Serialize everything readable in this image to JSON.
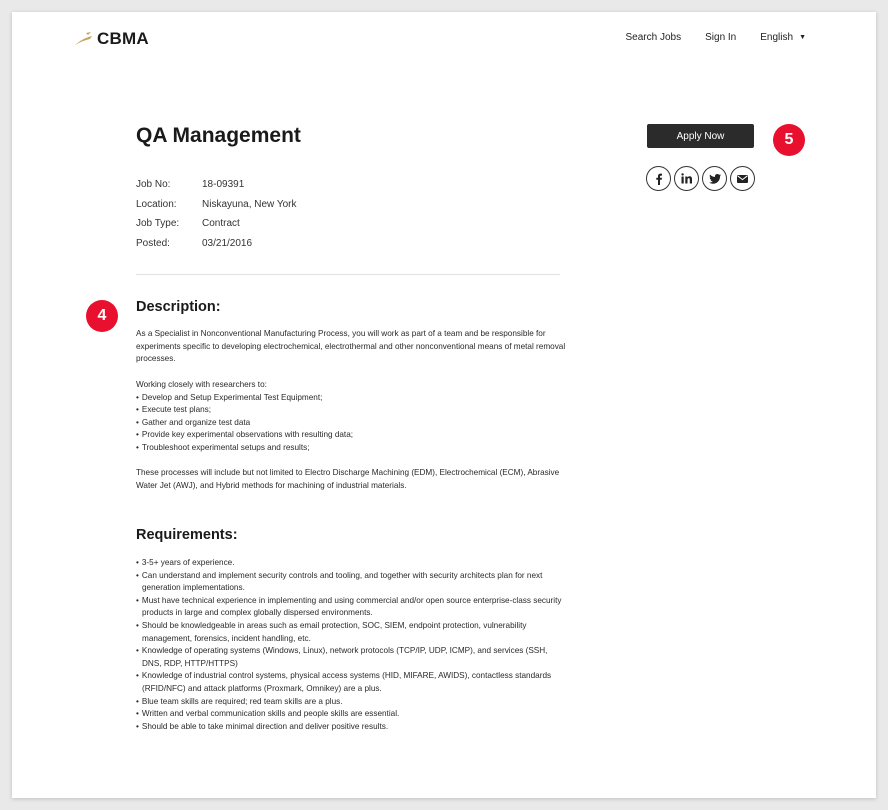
{
  "header": {
    "logo_text": "CBMA",
    "nav": {
      "search_jobs": "Search Jobs",
      "sign_in": "Sign In",
      "language": "English"
    }
  },
  "job": {
    "title": "QA Management",
    "meta": [
      {
        "label": "Job No:",
        "value": "18-09391"
      },
      {
        "label": "Location:",
        "value": "Niskayuna, New York"
      },
      {
        "label": "Job Type:",
        "value": "Contract"
      },
      {
        "label": "Posted:",
        "value": "03/21/2016"
      }
    ]
  },
  "actions": {
    "apply_label": "Apply Now",
    "share": [
      {
        "icon": "facebook-icon",
        "glyph": "f"
      },
      {
        "icon": "linkedin-icon",
        "glyph": "in"
      },
      {
        "icon": "twitter-icon",
        "glyph": "twitter"
      },
      {
        "icon": "email-icon",
        "glyph": "mail"
      }
    ]
  },
  "badges": {
    "description_badge": "4",
    "apply_badge": "5"
  },
  "description": {
    "heading": "Description:",
    "intro": "As a Specialist in Nonconventional Manufacturing Process, you will work as part of a team and be responsible for experiments specific to developing electrochemical, electrothermal and other nonconventional means of metal removal processes.",
    "work_intro": "Working closely with researchers to:",
    "work_items": [
      "Develop and Setup Experimental Test Equipment;",
      "Execute test plans;",
      "Gather and organize test data",
      "Provide key experimental observations with resulting data;",
      "Troubleshoot experimental setups and results;"
    ],
    "closing": "These processes will include but not limited to Electro Discharge Machining (EDM), Electrochemical (ECM), Abrasive Water Jet (AWJ), and Hybrid methods for machining of industrial materials."
  },
  "requirements": {
    "heading": "Requirements:",
    "items": [
      "3-5+ years of experience.",
      "Can understand and implement security controls and tooling, and together with security architects plan for next generation implementations.",
      "Must have technical experience in implementing and using commercial and/or open source enterprise-class security products in large and complex globally dispersed environments.",
      "Should be knowledgeable in areas such as email protection, SOC, SIEM, endpoint protection, vulnerability management, forensics, incident handling, etc.",
      "Knowledge of operating systems (Windows, Linux), network protocols (TCP/IP, UDP, ICMP), and services (SSH, DNS, RDP, HTTP/HTTPS)",
      "Knowledge of industrial control systems, physical access systems (HID, MIFARE, AWIDS), contactless standards (RFID/NFC) and attack platforms (Proxmark, Omnikey) are a plus.",
      "Blue team skills are required; red team skills are a plus.",
      "Written and verbal communication skills and people skills are essential.",
      "Should be able to take minimal direction and deliver positive results."
    ]
  },
  "colors": {
    "accent_badge": "#e8102e",
    "button_dark": "#2b2b2b",
    "logo_gold": "#c9a25a"
  }
}
